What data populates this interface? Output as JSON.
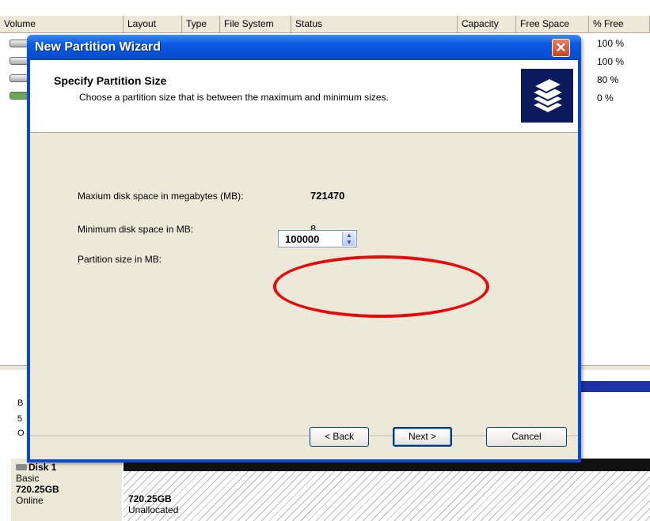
{
  "background": {
    "columns": [
      "Volume",
      "Layout",
      "Type",
      "File System",
      "Status",
      "Capacity",
      "Free Space",
      "% Free"
    ],
    "free_percentages": [
      "100 %",
      "100 %",
      "80 %",
      "0 %"
    ],
    "disk": {
      "name": "Disk 1",
      "type": "Basic",
      "size": "720.25GB",
      "state": "Online"
    },
    "unallocated": {
      "size": "720.25GB",
      "label": "Unallocated"
    },
    "lower_fragments": [
      "B",
      "5",
      "O"
    ]
  },
  "dialog": {
    "title": "New Partition Wizard",
    "close_glyph": "✕",
    "header_title": "Specify Partition Size",
    "header_subtitle": "Choose a partition size that is between the maximum and minimum sizes.",
    "max_label": "Maxium disk space in megabytes (MB):",
    "max_value": "721470",
    "min_label": "Minimum disk space in MB:",
    "min_value": "8",
    "size_label": "Partition size in MB:",
    "size_value": "100000",
    "buttons": {
      "back": "< Back",
      "next": "Next >",
      "cancel": "Cancel"
    }
  },
  "icons": {
    "header_graphic": "stacked-disks-icon",
    "annotation": "red-circle-annotation"
  },
  "colors": {
    "titlebar_blue": "#0552d6",
    "dialog_body": "#ece9d8",
    "close_button": "#c9421c",
    "annotation_red": "#e8090a"
  }
}
